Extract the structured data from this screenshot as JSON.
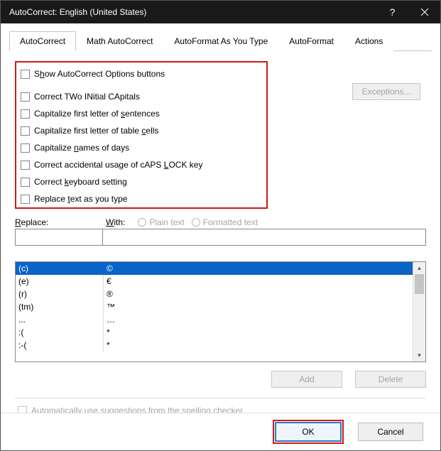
{
  "title": "AutoCorrect: English (United States)",
  "tabs": [
    "AutoCorrect",
    "Math AutoCorrect",
    "AutoFormat As You Type",
    "AutoFormat",
    "Actions"
  ],
  "exceptions_label": "Exceptions...",
  "checkboxes": [
    {
      "pre": "S",
      "u": "h",
      "post": "ow AutoCorrect Options buttons"
    },
    {
      "pre": "Correct TWo INitial CApitals",
      "u": "",
      "post": ""
    },
    {
      "pre": "Capitalize first letter of ",
      "u": "s",
      "post": "entences"
    },
    {
      "pre": "Capitalize first letter of table ",
      "u": "c",
      "post": "ells"
    },
    {
      "pre": "Capitalize ",
      "u": "n",
      "post": "ames of days"
    },
    {
      "pre": "Correct accidental usage of cAPS ",
      "u": "L",
      "post": "OCK key"
    },
    {
      "pre": "Correct ",
      "u": "k",
      "post": "eyboard setting"
    },
    {
      "pre": "Replace ",
      "u": "t",
      "post": "ext as you type"
    }
  ],
  "replace_label": {
    "pre": "",
    "u": "R",
    "post": "eplace:"
  },
  "with_label": {
    "pre": "",
    "u": "W",
    "post": "ith:"
  },
  "radio_plain": "Plain text",
  "radio_formatted": "Formatted text",
  "list": [
    {
      "a": "(c)",
      "b": "©"
    },
    {
      "a": "(e)",
      "b": "€"
    },
    {
      "a": "(r)",
      "b": "®"
    },
    {
      "a": "(tm)",
      "b": "™"
    },
    {
      "a": "...",
      "b": "…"
    },
    {
      "a": ":(",
      "b": "*"
    },
    {
      "a": ":-(",
      "b": "*"
    }
  ],
  "add_label": "Add",
  "delete_label": "Delete",
  "auto_suggest": "Automatically use suggestions from the spelling checker",
  "ok_label": "OK",
  "cancel_label": "Cancel"
}
